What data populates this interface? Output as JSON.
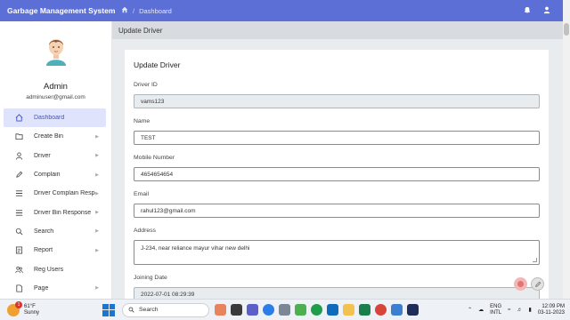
{
  "header": {
    "app_title": "Garbage Management System",
    "breadcrumb": "Dashboard",
    "accent_color": "#5c6fd6"
  },
  "sidebar": {
    "admin_name": "Admin",
    "admin_email": "adminuser@gmail.com",
    "items": [
      {
        "label": "Dashboard",
        "icon": "home-icon",
        "active": true
      },
      {
        "label": "Create Bin",
        "icon": "folder-icon"
      },
      {
        "label": "Driver",
        "icon": "user-icon"
      },
      {
        "label": "Complain",
        "icon": "pen-icon"
      },
      {
        "label": "Driver Complain Response",
        "icon": "list-icon"
      },
      {
        "label": "Driver Bin Response",
        "icon": "list-icon"
      },
      {
        "label": "Search",
        "icon": "search-icon"
      },
      {
        "label": "Report",
        "icon": "report-icon"
      },
      {
        "label": "Reg Users",
        "icon": "users-icon"
      },
      {
        "label": "Page",
        "icon": "page-icon"
      }
    ]
  },
  "page": {
    "header": "Update Driver",
    "card_title": "Update Driver"
  },
  "form": {
    "driver_id": {
      "label": "Driver ID",
      "value": "vams123"
    },
    "name": {
      "label": "Name",
      "value": "TEST"
    },
    "mobile": {
      "label": "Mobile Number",
      "value": "4654654654"
    },
    "email": {
      "label": "Email",
      "value": "rahul123@gmail.com"
    },
    "address": {
      "label": "Address",
      "value": "J-234, near reliance mayur vihar new delhi"
    },
    "joining_date": {
      "label": "Joining Date",
      "value": "2022-07-01 08:29:39"
    }
  },
  "taskbar": {
    "weather_temp": "61°F",
    "weather_desc": "Sunny",
    "weather_badge": "1",
    "search_placeholder": "Search",
    "lang_top": "ENG",
    "lang_bottom": "INTL",
    "time": "12:09 PM",
    "date": "03-11-2023"
  }
}
